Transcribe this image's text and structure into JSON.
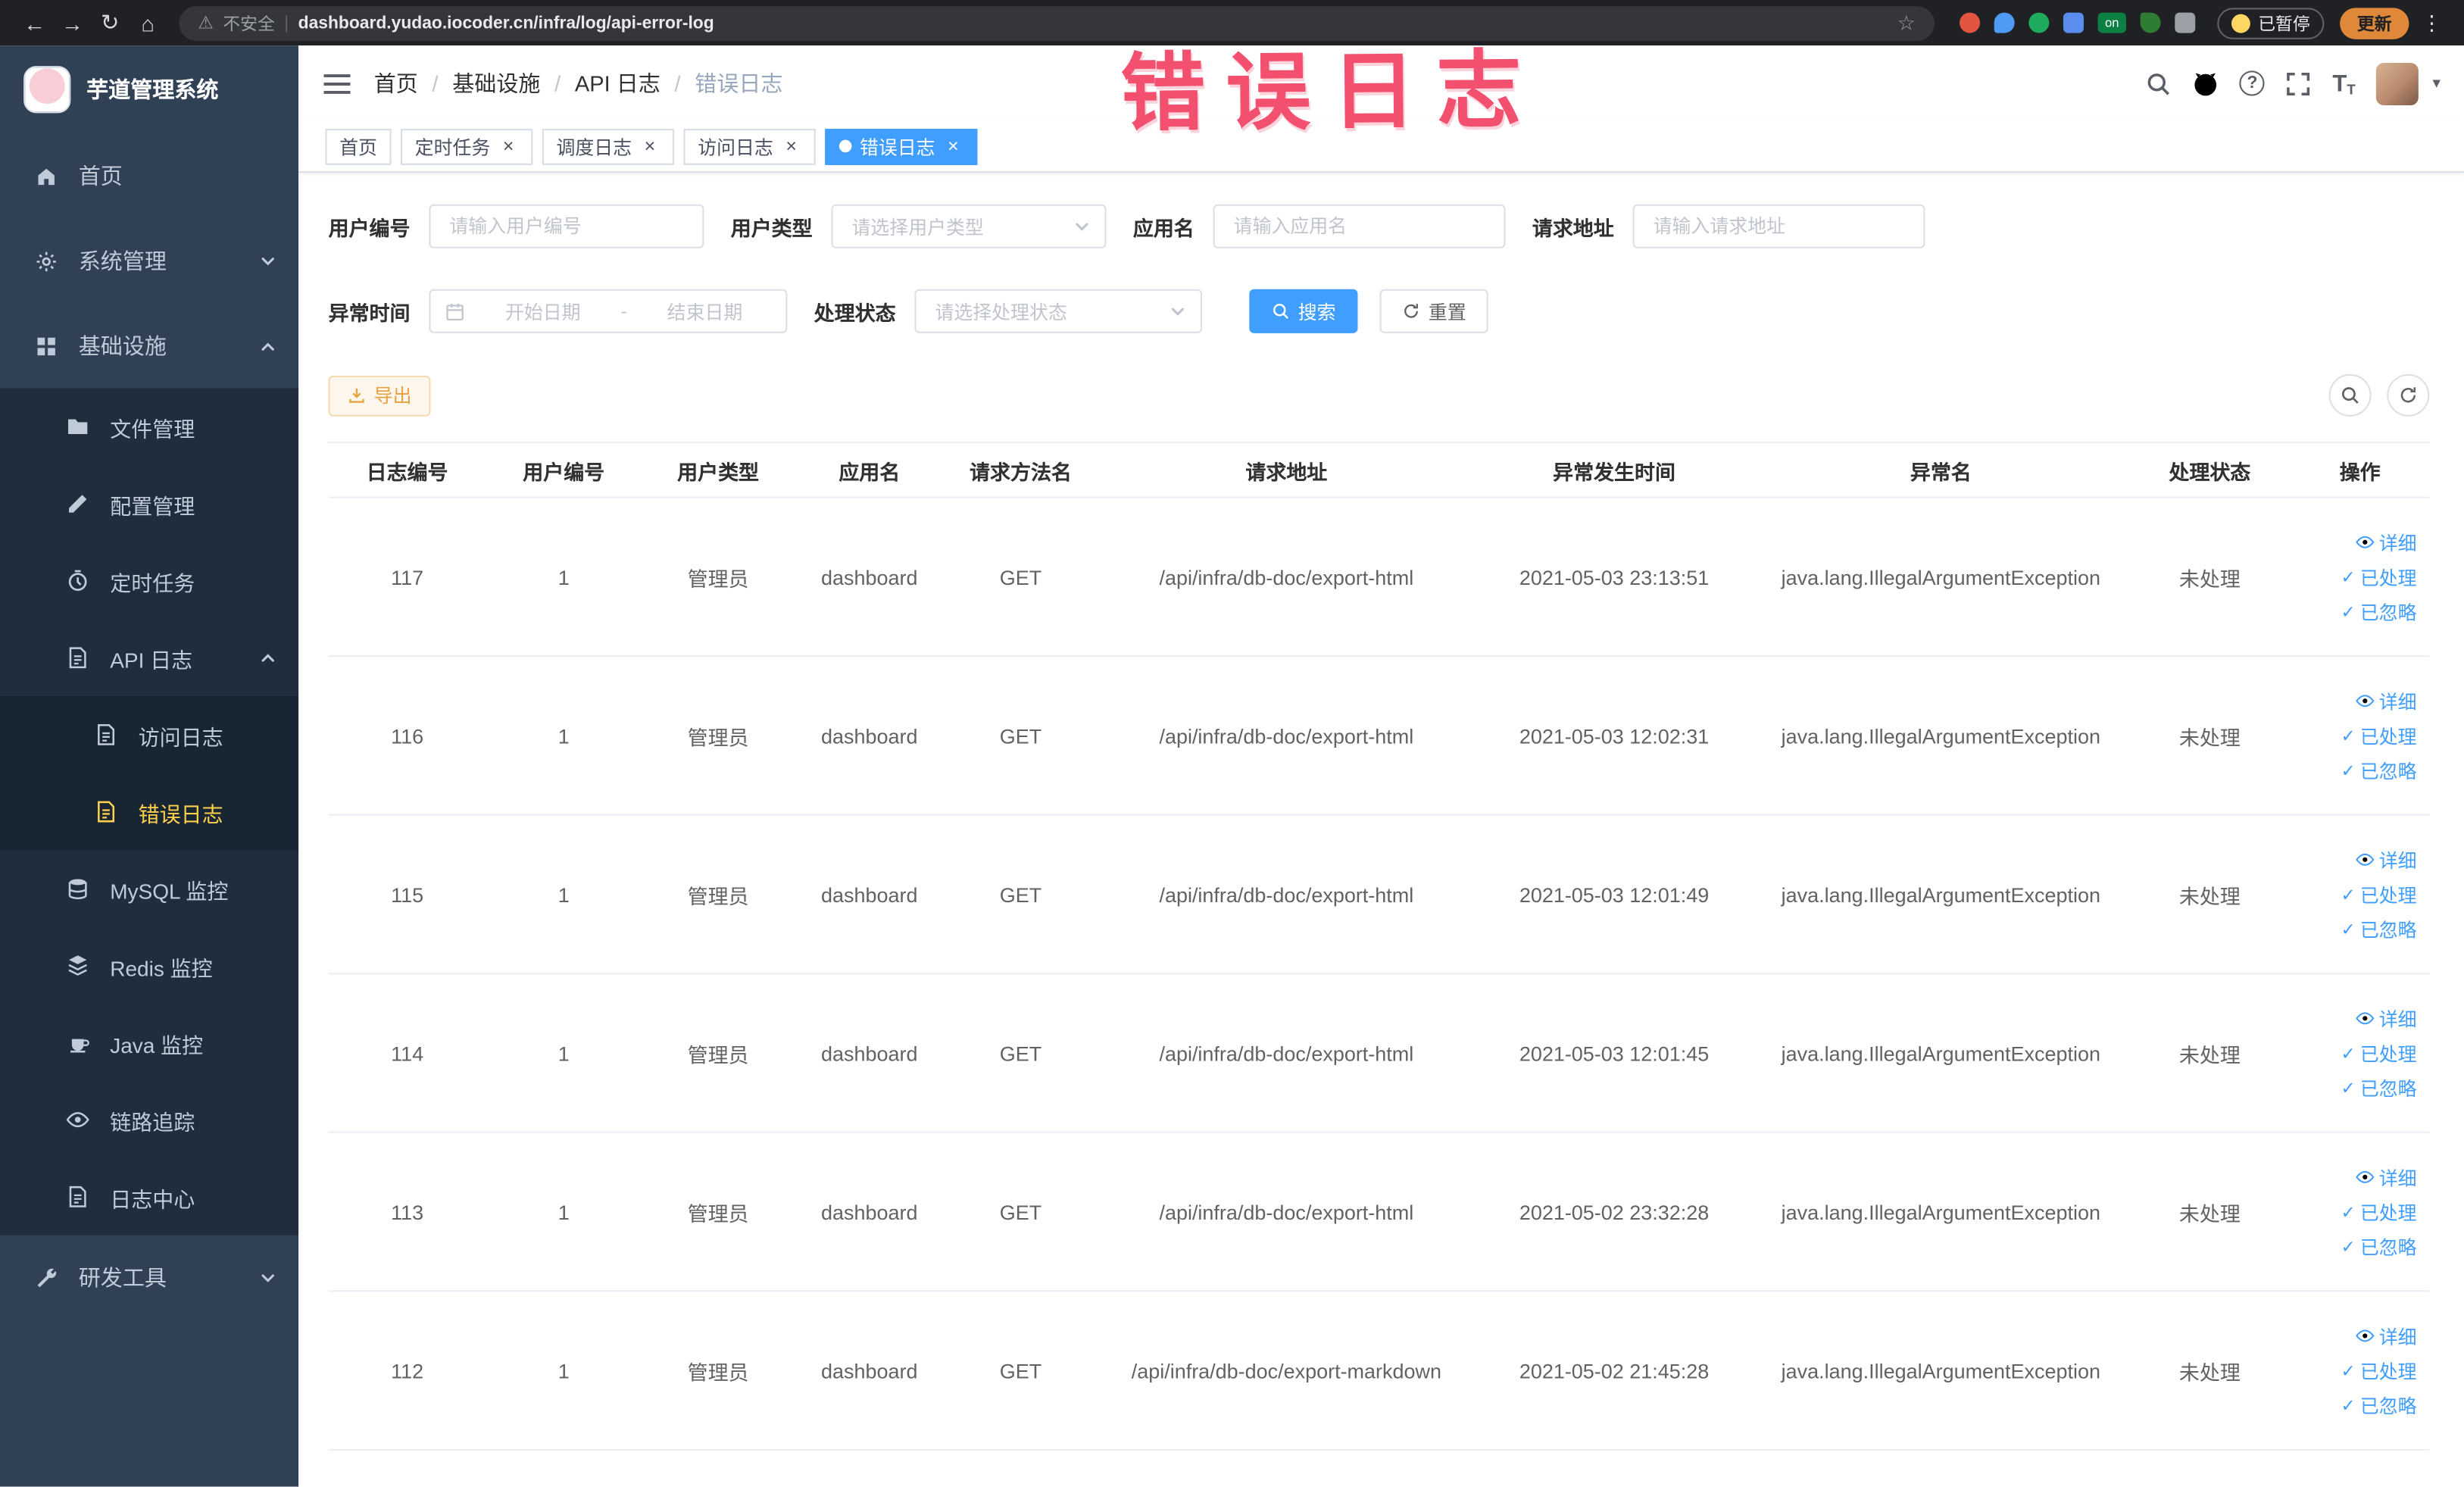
{
  "annotation": {
    "text": "错误日志"
  },
  "icons": {
    "back": "←",
    "forward": "→",
    "reload": "↻",
    "home": "⌂",
    "warning": "⚠",
    "divider": "|",
    "star": "☆",
    "more": "⋮",
    "question": "?",
    "caret": "▾",
    "check": "✓",
    "font_letter": "T"
  },
  "browser": {
    "security_label": "不安全",
    "url": "dashboard.yudao.iocoder.cn/infra/log/api-error-log",
    "ext_on_label": "on",
    "paused_label": "已暂停",
    "update_label": "更新"
  },
  "sidebar": {
    "title": "芋道管理系统",
    "home": "首页",
    "system": "系统管理",
    "infra": "基础设施",
    "infra_children": {
      "file": "文件管理",
      "config": "配置管理",
      "job": "定时任务",
      "api_log": "API 日志",
      "access_log": "访问日志",
      "error_log": "错误日志",
      "mysql": "MySQL 监控",
      "redis": "Redis 监控",
      "java": "Java 监控",
      "trace": "链路追踪",
      "log_center": "日志中心"
    },
    "dev_tools": "研发工具"
  },
  "breadcrumb": {
    "separator": "/",
    "items": [
      "首页",
      "基础设施",
      "API 日志",
      "错误日志"
    ]
  },
  "tags": [
    {
      "label": "首页"
    },
    {
      "label": "定时任务"
    },
    {
      "label": "调度日志"
    },
    {
      "label": "访问日志"
    },
    {
      "label": "错误日志"
    }
  ],
  "filters": {
    "user_id_label": "用户编号",
    "user_id_placeholder": "请输入用户编号",
    "user_type_label": "用户类型",
    "user_type_placeholder": "请选择用户类型",
    "app_name_label": "应用名",
    "app_name_placeholder": "请输入应用名",
    "request_url_label": "请求地址",
    "request_url_placeholder": "请输入请求地址",
    "exception_time_label": "异常时间",
    "date_start_placeholder": "开始日期",
    "date_separator": "-",
    "date_end_placeholder": "结束日期",
    "status_label": "处理状态",
    "status_placeholder": "请选择处理状态",
    "search_label": "搜索",
    "reset_label": "重置"
  },
  "toolbar": {
    "export_label": "导出"
  },
  "table": {
    "columns": [
      "日志编号",
      "用户编号",
      "用户类型",
      "应用名",
      "请求方法名",
      "请求地址",
      "异常发生时间",
      "异常名",
      "处理状态",
      "操作"
    ],
    "actions": {
      "detail": "详细",
      "processed": "已处理",
      "ignored": "已忽略"
    },
    "rows": [
      {
        "id": "117",
        "user_id": "1",
        "user_type": "管理员",
        "app": "dashboard",
        "method": "GET",
        "url": "/api/infra/db-doc/export-html",
        "time": "2021-05-03 23:13:51",
        "exception": "java.lang.IllegalArgumentException",
        "status": "未处理"
      },
      {
        "id": "116",
        "user_id": "1",
        "user_type": "管理员",
        "app": "dashboard",
        "method": "GET",
        "url": "/api/infra/db-doc/export-html",
        "time": "2021-05-03 12:02:31",
        "exception": "java.lang.IllegalArgumentException",
        "status": "未处理"
      },
      {
        "id": "115",
        "user_id": "1",
        "user_type": "管理员",
        "app": "dashboard",
        "method": "GET",
        "url": "/api/infra/db-doc/export-html",
        "time": "2021-05-03 12:01:49",
        "exception": "java.lang.IllegalArgumentException",
        "status": "未处理"
      },
      {
        "id": "114",
        "user_id": "1",
        "user_type": "管理员",
        "app": "dashboard",
        "method": "GET",
        "url": "/api/infra/db-doc/export-html",
        "time": "2021-05-03 12:01:45",
        "exception": "java.lang.IllegalArgumentException",
        "status": "未处理"
      },
      {
        "id": "113",
        "user_id": "1",
        "user_type": "管理员",
        "app": "dashboard",
        "method": "GET",
        "url": "/api/infra/db-doc/export-html",
        "time": "2021-05-02 23:32:28",
        "exception": "java.lang.IllegalArgumentException",
        "status": "未处理"
      },
      {
        "id": "112",
        "user_id": "1",
        "user_type": "管理员",
        "app": "dashboard",
        "method": "GET",
        "url": "/api/infra/db-doc/export-markdown",
        "time": "2021-05-02 21:45:28",
        "exception": "java.lang.IllegalArgumentException",
        "status": "未处理"
      }
    ]
  }
}
